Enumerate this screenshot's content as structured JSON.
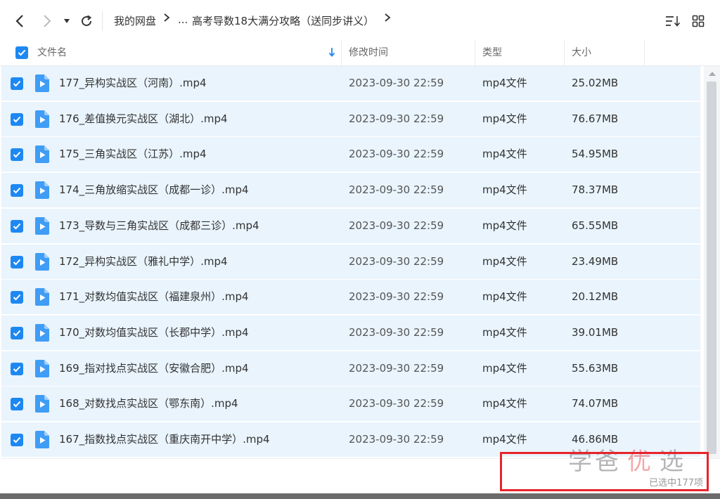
{
  "toolbar": {
    "back_icon": "chevron-left-icon",
    "forward_icon": "chevron-right-icon",
    "history_icon": "caret-down-icon",
    "refresh_icon": "refresh-icon",
    "breadcrumb": {
      "root": "我的网盘",
      "ellipsis": "...",
      "current": "高考导数18大满分攻略（送同步讲义）"
    },
    "sort_icon": "sort-icon",
    "grid_icon": "grid-view-icon"
  },
  "header": {
    "name": "文件名",
    "modified": "修改时间",
    "type": "类型",
    "size": "大小"
  },
  "files": [
    {
      "name": "177_异构实战区（河南）.mp4",
      "time": "2023-09-30 22:59",
      "type": "mp4文件",
      "size": "25.02MB"
    },
    {
      "name": "176_差值换元实战区（湖北）.mp4",
      "time": "2023-09-30 22:59",
      "type": "mp4文件",
      "size": "76.67MB"
    },
    {
      "name": "175_三角实战区（江苏）.mp4",
      "time": "2023-09-30 22:59",
      "type": "mp4文件",
      "size": "54.95MB"
    },
    {
      "name": "174_三角放缩实战区（成都一诊）.mp4",
      "time": "2023-09-30 22:59",
      "type": "mp4文件",
      "size": "78.37MB"
    },
    {
      "name": "173_导数与三角实战区（成都三诊）.mp4",
      "time": "2023-09-30 22:59",
      "type": "mp4文件",
      "size": "65.55MB"
    },
    {
      "name": "172_异构实战区（雅礼中学）.mp4",
      "time": "2023-09-30 22:59",
      "type": "mp4文件",
      "size": "23.49MB"
    },
    {
      "name": "171_对数均值实战区（福建泉州）.mp4",
      "time": "2023-09-30 22:59",
      "type": "mp4文件",
      "size": "20.12MB"
    },
    {
      "name": "170_对数均值实战区（长郡中学）.mp4",
      "time": "2023-09-30 22:59",
      "type": "mp4文件",
      "size": "39.01MB"
    },
    {
      "name": "169_指对找点实战区（安徽合肥）.mp4",
      "time": "2023-09-30 22:59",
      "type": "mp4文件",
      "size": "55.63MB"
    },
    {
      "name": "168_对数找点实战区（鄂东南）.mp4",
      "time": "2023-09-30 22:59",
      "type": "mp4文件",
      "size": "74.07MB"
    },
    {
      "name": "167_指数找点实战区（重庆南开中学）.mp4",
      "time": "2023-09-30 22:59",
      "type": "mp4文件",
      "size": "46.86MB"
    }
  ],
  "footer": {
    "status": "已选中177项"
  },
  "watermark": {
    "text1": "学爸",
    "seal": "优",
    "text2": "选"
  },
  "colors": {
    "accent": "#1e88f2",
    "row_selected_bg": "#e9f4fd",
    "highlight_box": "#e8232b"
  }
}
